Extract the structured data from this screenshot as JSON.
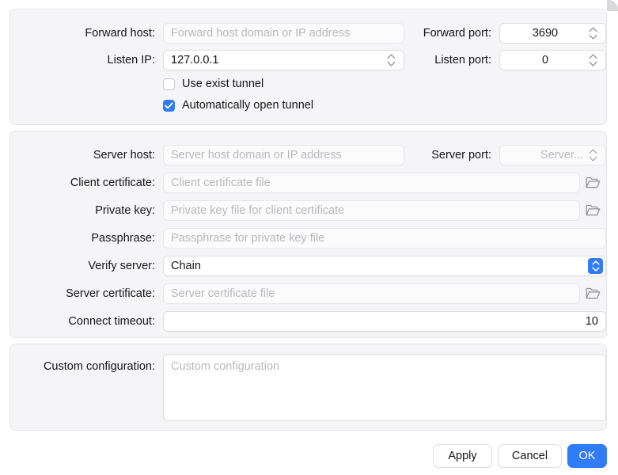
{
  "window": {
    "accent_color": "#2f7cf6",
    "panel_bg": "#f5f5f7",
    "field_bg": "#ffffff",
    "placeholder_color": "#b9b9bd",
    "text_color": "#15151a"
  },
  "forward_section": {
    "forward_host": {
      "label": "Forward host:",
      "placeholder": "Forward host domain or IP address",
      "value": ""
    },
    "forward_port": {
      "label": "Forward port:",
      "value": "3690"
    },
    "listen_ip": {
      "label": "Listen IP:",
      "value": "127.0.0.1"
    },
    "listen_port": {
      "label": "Listen port:",
      "value": "0"
    },
    "use_exist_tunnel": {
      "label": "Use exist tunnel",
      "checked": false
    },
    "auto_open_tunnel": {
      "label": "Automatically open tunnel",
      "checked": true
    }
  },
  "server_section": {
    "server_host": {
      "label": "Server host:",
      "placeholder": "Server host domain or IP address",
      "value": ""
    },
    "server_port": {
      "label": "Server port:",
      "placeholder": "Server...",
      "value": ""
    },
    "client_certificate": {
      "label": "Client certificate:",
      "placeholder": "Client certificate file",
      "value": ""
    },
    "private_key": {
      "label": "Private key:",
      "placeholder": "Private key file for client certificate",
      "value": ""
    },
    "passphrase": {
      "label": "Passphrase:",
      "placeholder": "Passphrase for private key file",
      "value": ""
    },
    "verify_server": {
      "label": "Verify server:",
      "value": "Chain"
    },
    "server_certificate": {
      "label": "Server certificate:",
      "placeholder": "Server certificate file",
      "value": ""
    },
    "connect_timeout": {
      "label": "Connect timeout:",
      "value": "10"
    }
  },
  "custom_section": {
    "custom_configuration": {
      "label": "Custom configuration:",
      "placeholder": "Custom configuration",
      "value": ""
    }
  },
  "footer": {
    "apply_label": "Apply",
    "cancel_label": "Cancel",
    "ok_label": "OK"
  },
  "icons": {
    "stepper": "chevron-up-down-icon",
    "popup": "popup-chevron-up-down-icon",
    "browse": "folder-icon",
    "checkmark": "checkmark-icon"
  }
}
